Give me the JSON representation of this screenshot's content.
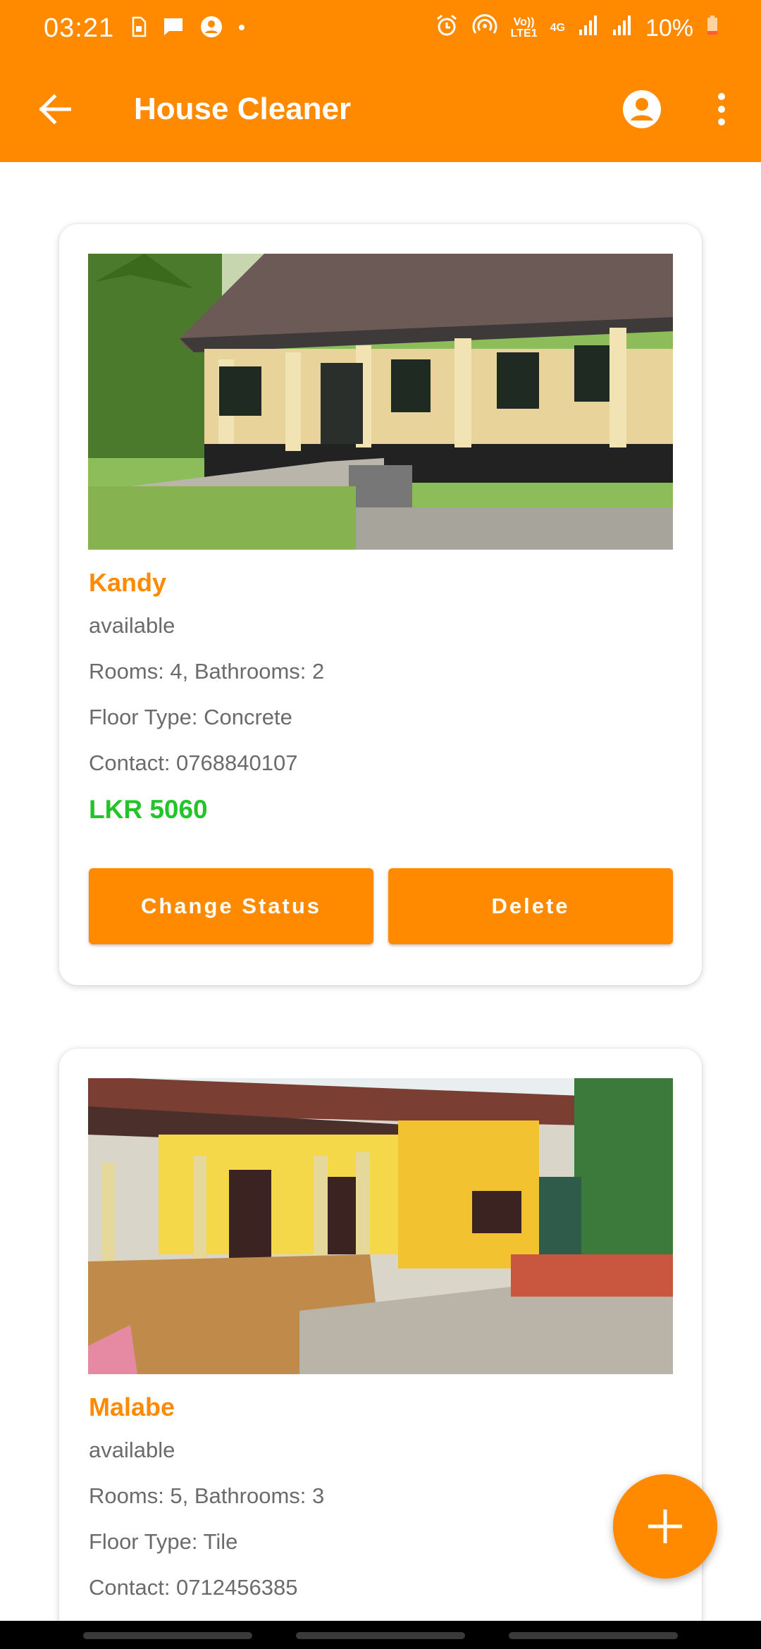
{
  "status_bar": {
    "time": "03:21",
    "left_icons": [
      "sim-icon",
      "chat-icon",
      "account-circle-icon",
      "dot-icon"
    ],
    "volte_line1": "Vo))",
    "volte_line2": "LTE1",
    "network": "4G",
    "battery": "10%"
  },
  "app_bar": {
    "title": "House Cleaner",
    "back_icon": "arrow-back-icon",
    "account_icon": "account-circle-icon",
    "menu_icon": "more-vert-icon"
  },
  "listings": [
    {
      "location": "Kandy",
      "status": "available",
      "rooms_line": "Rooms: 4, Bathrooms: 2",
      "floor_line": "Floor Type: Concrete",
      "contact_line": "Contact: 0768840107",
      "price": "LKR 5060",
      "change_status_label": "Change Status",
      "delete_label": "Delete"
    },
    {
      "location": "Malabe",
      "status": "available",
      "rooms_line": "Rooms: 5, Bathrooms: 3",
      "floor_line": "Floor Type: Tile",
      "contact_line": "Contact: 0712456385"
    }
  ],
  "fab": {
    "icon": "add-icon"
  },
  "colors": {
    "primary": "#FF8A00",
    "price": "#22C42A",
    "secondary_text": "#6b6b6b"
  }
}
